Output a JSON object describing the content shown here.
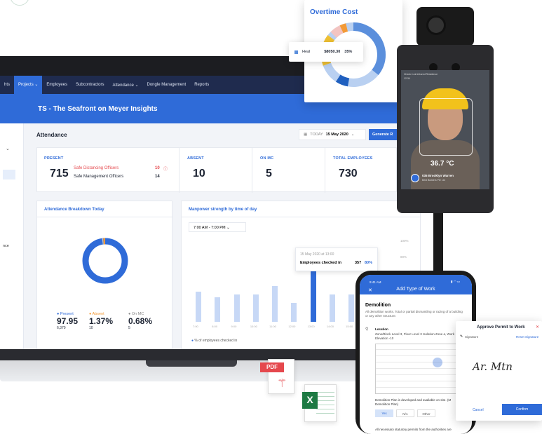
{
  "nav": {
    "items": [
      "hts",
      "Projects",
      "Employees",
      "Subcontractors",
      "Attendance",
      "Dongle Management",
      "Reports"
    ]
  },
  "project_title": "TS - The Seafront on Meyer Insights",
  "sidebar_frag": "nce",
  "attendance": {
    "title": "Attendance",
    "today_label": "TODAY",
    "date": "15 May 2020",
    "generate_label": "Generate R"
  },
  "stats": {
    "present_label": "PRESENT",
    "present_value": "715",
    "sdo_label": "Safe Distancing Officers",
    "sdo_value": "10",
    "smo_label": "Safe Management Officers",
    "smo_value": "14",
    "absent_label": "ABSENT",
    "absent_value": "10",
    "mc_label": "ON MC",
    "mc_value": "5",
    "total_label": "TOTAL EMPLOYEES",
    "total_value": "730"
  },
  "breakdown": {
    "title": "Attendance Breakdown Today",
    "legend": [
      {
        "label": "Present",
        "pct": "97.95",
        "count": "6,370",
        "color": "#2f6bd8"
      },
      {
        "label": "Absent",
        "pct": "1.37%",
        "count": "10",
        "color": "#f39a36"
      },
      {
        "label": "On MC",
        "pct": "0.68%",
        "count": "5",
        "color": "#bfc6d2"
      }
    ]
  },
  "manpower": {
    "title": "Manpower strength by time of day",
    "range": "7:00 AM - 7:00 PM",
    "y_ticks": [
      "100%",
      "80%"
    ],
    "x_ticks": [
      "7:00",
      "8:00",
      "9:00",
      "10:00",
      "11:00",
      "12:00",
      "13:00",
      "14:00",
      "15:00",
      "16:00",
      "17:00"
    ],
    "bars": [
      0.42,
      0.34,
      0.38,
      0.38,
      0.5,
      0.26,
      1.0,
      0.38,
      0.38,
      0.52,
      0.56
    ],
    "tooltip_date": "15 May 2020 at 13:00",
    "tooltip_label": "Employees checked in",
    "tooltip_value": "357",
    "tooltip_pct": "80%",
    "legend": "% of employees checked in"
  },
  "overtime": {
    "title": "Overtime Cost",
    "tip_label": "Heal",
    "tip_value": "$8050.30",
    "tip_pct": "35%"
  },
  "device": {
    "temperature": "36.7 °C",
    "person": "035 Brooklyn Warren",
    "company": "Best Builders Pte Ltd",
    "notice": "Check in at Infrared Residence",
    "time": "12:34"
  },
  "phone": {
    "time": "9:41 AM",
    "title": "Add Type of Work",
    "section": "Demolition",
    "desc": "All demolition works. Total or partial dismantling or razing of a building or any other structure.",
    "location_label": "Location",
    "location_value": "Zone/Block Level 3, Floor Level 3 Isolation Zone a, Work Elevation -10",
    "item1": "Demolition Plan is developed and available on site. (M Demolition Plan)",
    "yes": "Yes",
    "na": "N/A",
    "other": "Other",
    "item2": "All necessary statutory permits from the authorities are"
  },
  "approve": {
    "title": "Approve Permit to Work",
    "signature_label": "Signature",
    "reset_label": "Reset Signature",
    "signature_text": "Ar. Mtn",
    "cancel": "Cancel",
    "confirm": "Confirm"
  },
  "files": {
    "pdf": "PDF",
    "excel": "X"
  },
  "colors": {
    "primary": "#2f6bd8",
    "nav": "#1f2b4e",
    "alert": "#e5484d",
    "excel": "#1d7a43"
  }
}
